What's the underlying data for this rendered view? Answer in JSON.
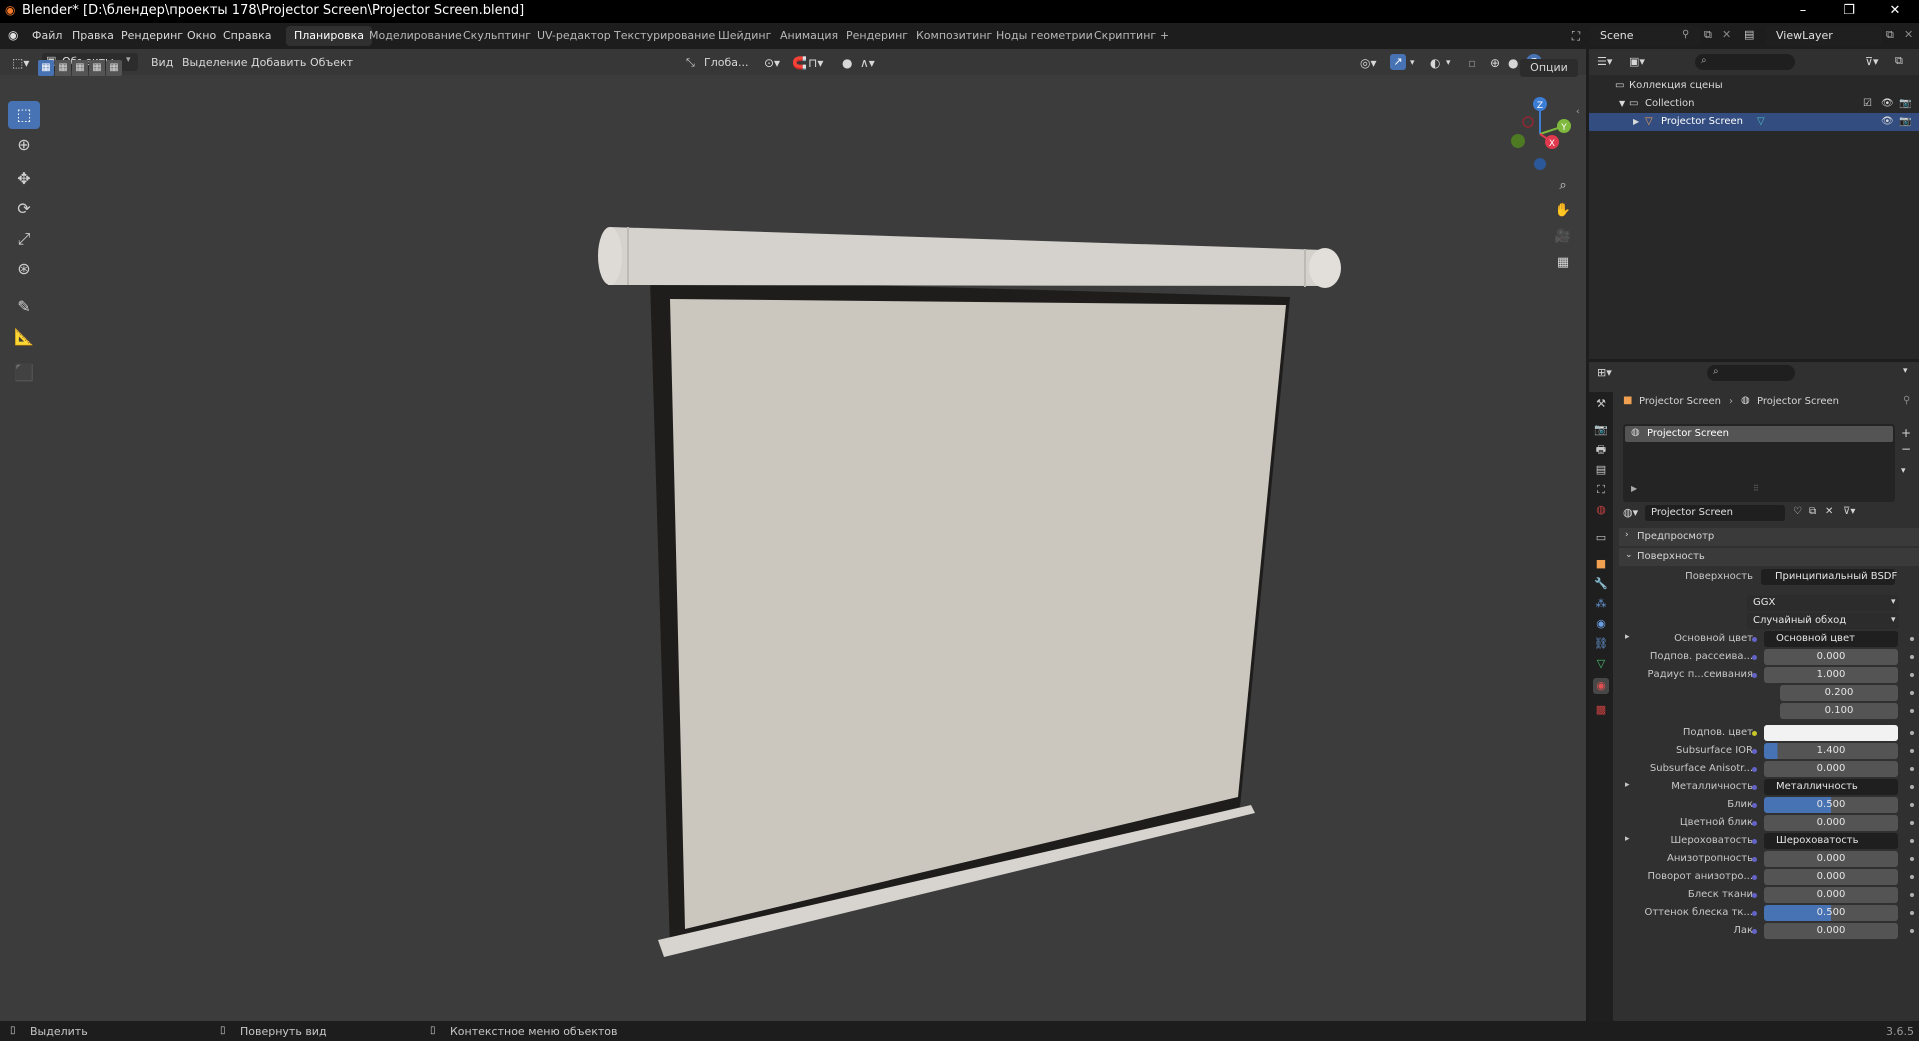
{
  "window": {
    "title": "Blender* [D:\\блендер\\проекты 178\\Projector Screen\\Projector Screen.blend]",
    "controls": [
      "–",
      "❐",
      "✕"
    ]
  },
  "menu": {
    "items": [
      "Файл",
      "Правка",
      "Рендеринг",
      "Окно",
      "Справка"
    ],
    "workspaces": [
      "Планировка",
      "Моделирование",
      "Скульптинг",
      "UV-редактор",
      "Текстурирование",
      "Шейдинг",
      "Анимация",
      "Рендеринг",
      "Композитинг",
      "Ноды геометрии",
      "Скриптинг"
    ],
    "add_workspace": "+",
    "scene": "Scene",
    "view_layer": "ViewLayer"
  },
  "viewport": {
    "mode": "Объекты",
    "menus": [
      "Вид",
      "Выделение",
      "Добавить",
      "Объект"
    ],
    "transform_orientation": "Глоба...",
    "options": "Опции",
    "gizmo_axes": [
      "Z",
      "Y",
      "X"
    ],
    "colors": {
      "x": "#e0384c",
      "y": "#7eb83c",
      "z": "#3c7ed6",
      "accent": "#4772b3"
    }
  },
  "outliner": {
    "rows": [
      {
        "label": "Коллекция сцены"
      },
      {
        "label": "Collection"
      },
      {
        "label": "Projector Screen",
        "selected": true
      }
    ]
  },
  "properties": {
    "breadcrumb": [
      "Projector Screen",
      "Projector Screen"
    ],
    "slot_material": "Projector Screen",
    "material_name": "Projector Screen",
    "panels": {
      "preview": "Предпросмотр",
      "surface": "Поверхность"
    },
    "surface": {
      "label": "Поверхность",
      "value": "Принципиальный BSDF"
    },
    "distribution": "GGX",
    "subsurface_method": "Случайный обход",
    "rows": [
      {
        "label": "Основной цвет",
        "value": "Основной цвет",
        "type": "link",
        "expand": true
      },
      {
        "label": "Подпов. рассеива...",
        "value": "0.000"
      },
      {
        "label": "Радиус п...сеивания",
        "value": "1.000"
      },
      {
        "label": "",
        "value": "0.200"
      },
      {
        "label": "",
        "value": "0.100"
      },
      {
        "label": "Подпов. цвет",
        "value": "",
        "type": "color"
      },
      {
        "label": "Subsurface IOR",
        "value": "1.400",
        "fill": 0.1
      },
      {
        "label": "Subsurface Anisotr...",
        "value": "0.000"
      },
      {
        "label": "Металличность",
        "value": "Металличность",
        "type": "link",
        "expand": true
      },
      {
        "label": "Блик",
        "value": "0.500",
        "fill": 0.5
      },
      {
        "label": "Цветной блик",
        "value": "0.000"
      },
      {
        "label": "Шероховатость",
        "value": "Шероховатость",
        "type": "link",
        "expand": true
      },
      {
        "label": "Анизотропность",
        "value": "0.000"
      },
      {
        "label": "Поворот анизотро...",
        "value": "0.000"
      },
      {
        "label": "Блеск ткани",
        "value": "0.000"
      },
      {
        "label": "Оттенок блеска тк...",
        "value": "0.500",
        "fill": 0.5
      },
      {
        "label": "Лак",
        "value": "0.000"
      }
    ]
  },
  "status": {
    "items": [
      "Выделить",
      "Повернуть вид",
      "Контекстное меню объектов"
    ],
    "version": "3.6.5"
  }
}
